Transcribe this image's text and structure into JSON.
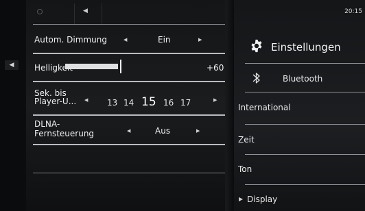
{
  "status": {
    "time": "20:15"
  },
  "left_panel": {
    "rows": [
      {
        "label": "Autom. Dimmung",
        "value": "Ein"
      },
      {
        "label": "Helligkeit",
        "value": "+60",
        "fill": 0.6
      },
      {
        "label_line1": "Sek. bis",
        "label_line2": "Player-U...",
        "options": [
          "13",
          "14",
          "15",
          "16",
          "17"
        ],
        "selected": "15"
      },
      {
        "label_line1": "DLNA-",
        "label_line2": "Fernsteuerung",
        "value": "Aus"
      }
    ]
  },
  "settings": {
    "title": "Einstellungen",
    "items": [
      {
        "label": "Bluetooth"
      },
      {
        "label": "International"
      },
      {
        "label": "Zeit"
      },
      {
        "label": "Ton"
      },
      {
        "label": "Display"
      }
    ]
  },
  "icons": {
    "gear": "gear-icon",
    "bluetooth": "bluetooth-icon",
    "speaker": "speaker-icon",
    "dot": "dot-icon"
  }
}
